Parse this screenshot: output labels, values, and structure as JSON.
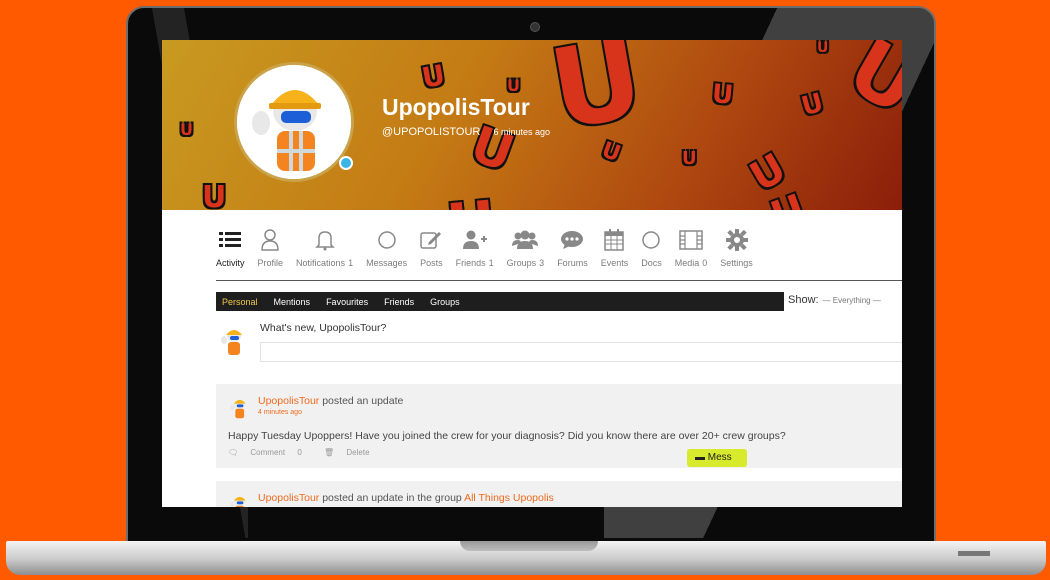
{
  "profile": {
    "name": "UpopolisTour",
    "handle": "@UPOPOLISTOUR",
    "last_active": "6 minutes ago"
  },
  "nav": {
    "items": [
      {
        "label": "Activity",
        "count": "",
        "icon": "list-icon",
        "active": true
      },
      {
        "label": "Profile",
        "count": "",
        "icon": "user-icon",
        "active": false
      },
      {
        "label": "Notifications",
        "count": "1",
        "icon": "bell-icon",
        "active": false
      },
      {
        "label": "Messages",
        "count": "",
        "icon": "circle-icon",
        "active": false
      },
      {
        "label": "Posts",
        "count": "",
        "icon": "edit-icon",
        "active": false
      },
      {
        "label": "Friends",
        "count": "1",
        "icon": "user-plus-icon",
        "active": false
      },
      {
        "label": "Groups",
        "count": "3",
        "icon": "users-icon",
        "active": false
      },
      {
        "label": "Forums",
        "count": "",
        "icon": "chat-bubble-icon",
        "active": false
      },
      {
        "label": "Events",
        "count": "",
        "icon": "calendar-icon",
        "active": false
      },
      {
        "label": "Docs",
        "count": "",
        "icon": "circle-icon",
        "active": false
      },
      {
        "label": "Media",
        "count": "0",
        "icon": "film-icon",
        "active": false
      },
      {
        "label": "Settings",
        "count": "",
        "icon": "gear-icon",
        "active": false
      }
    ]
  },
  "subnav": {
    "items": [
      "Personal",
      "Mentions",
      "Favourites",
      "Friends",
      "Groups"
    ],
    "active": "Personal",
    "show_label": "Show:",
    "show_value": "— Everything —"
  },
  "whats_new": {
    "label": "What's new, UpopolisTour?",
    "placeholder": ""
  },
  "activity": [
    {
      "author": "UpopolisTour",
      "action": "posted an update",
      "time": "4 minutes ago",
      "body": "Happy Tuesday Upoppers! Have you joined the crew for your diagnosis? Did you know there are over 20+ crew groups?",
      "comment_label": "Comment",
      "comment_count": "0",
      "delete_label": "Delete"
    },
    {
      "author": "UpopolisTour",
      "action": "posted an update in the group",
      "group": "All Things Upopolis",
      "message_button": "Mess"
    }
  ],
  "colors": {
    "background": "#ff5a00",
    "accent": "#f06a1e",
    "subnav_active": "#f2c94c",
    "message_button": "#d7ea2b"
  }
}
